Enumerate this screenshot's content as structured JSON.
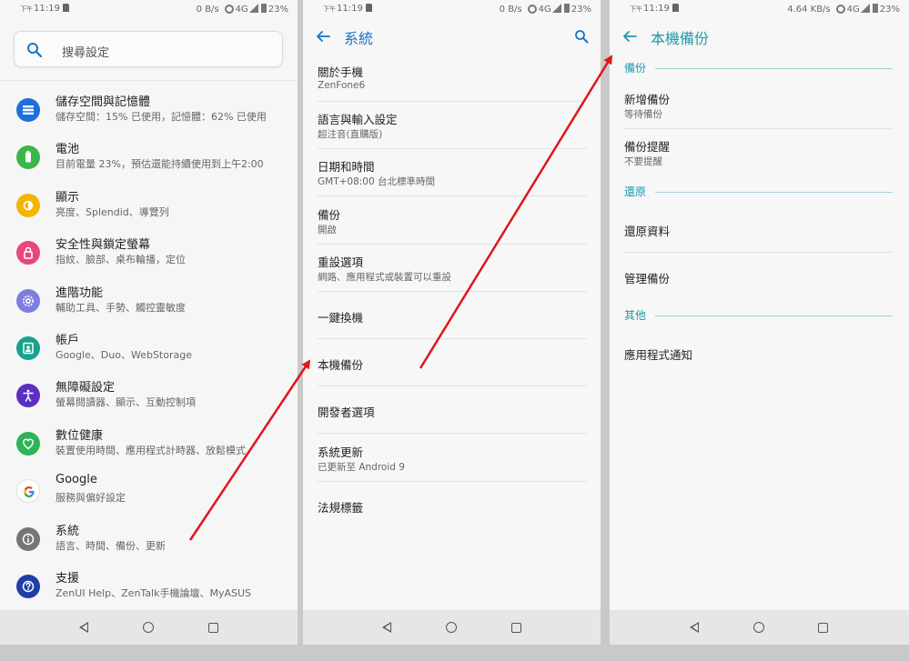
{
  "status": {
    "ampm": "下午",
    "time": "11:19",
    "speed_p1": "0 B/s",
    "speed_p2": "0 B/s",
    "speed_p3": "4.64 KB/s",
    "network": "4G",
    "battery": "23%"
  },
  "settings": {
    "search_placeholder": "搜尋設定",
    "items": [
      {
        "title": "儲存空間與記憶體",
        "subtitle": "儲存空間：15% 已使用，記憶體：62% 已使用",
        "icon": "storage-icon",
        "color": "#1e6fd9"
      },
      {
        "title": "電池",
        "subtitle": "目前電量 23%，預估還能持續使用到上午2:00",
        "icon": "battery-icon",
        "color": "#3cb54a"
      },
      {
        "title": "顯示",
        "subtitle": "亮度、Splendid、導覽列",
        "icon": "display-icon",
        "color": "#f4b400"
      },
      {
        "title": "安全性與鎖定螢幕",
        "subtitle": "指紋、臉部、桌布輪播，定位",
        "icon": "lock-icon",
        "color": "#e8477a"
      },
      {
        "title": "進階功能",
        "subtitle": "輔助工具、手勢、觸控靈敏度",
        "icon": "advanced-gear-icon",
        "color": "#7e7ee0"
      },
      {
        "title": "帳戶",
        "subtitle": "Google、Duo、WebStorage",
        "icon": "account-icon",
        "color": "#17a28c"
      },
      {
        "title": "無障礙設定",
        "subtitle": "螢幕閱讀器、顯示、互動控制項",
        "icon": "accessibility-icon",
        "color": "#5b2ec4"
      },
      {
        "title": "數位健康",
        "subtitle": "裝置使用時間、應用程式計時器、放鬆模式",
        "icon": "wellbeing-icon",
        "color": "#2db456"
      },
      {
        "title": "Google",
        "subtitle": "服務與偏好設定",
        "icon": "google-icon",
        "color": "#1a73e8"
      },
      {
        "title": "系統",
        "subtitle": "語言、時間、備份、更新",
        "icon": "info-icon",
        "color": "#757575"
      },
      {
        "title": "支援",
        "subtitle": "ZenUI Help、ZenTalk手機論壇、MyASUS",
        "icon": "help-icon",
        "color": "#1e3fa8"
      }
    ]
  },
  "system": {
    "title": "系統",
    "items": [
      {
        "title": "關於手機",
        "subtitle": "ZenFone6"
      },
      {
        "title": "語言與輸入設定",
        "subtitle": "超注音(直購版)"
      },
      {
        "title": "日期和時間",
        "subtitle": "GMT+08:00 台北標準時間"
      },
      {
        "title": "備份",
        "subtitle": "開啟"
      },
      {
        "title": "重設選項",
        "subtitle": "網路、應用程式或裝置可以重設"
      },
      {
        "title": "一鍵換機",
        "subtitle": ""
      },
      {
        "title": "本機備份",
        "subtitle": ""
      },
      {
        "title": "開發者選項",
        "subtitle": ""
      },
      {
        "title": "系統更新",
        "subtitle": "已更新至 Android 9"
      },
      {
        "title": "法規標籤",
        "subtitle": ""
      }
    ]
  },
  "local_backup": {
    "title": "本機備份",
    "sections": [
      {
        "header": "備份",
        "items": [
          {
            "title": "新增備份",
            "subtitle": "等待備份"
          },
          {
            "title": "備份提醒",
            "subtitle": "不要提醒"
          }
        ]
      },
      {
        "header": "還原",
        "items": [
          {
            "title": "還原資料",
            "subtitle": ""
          },
          {
            "title": "管理備份",
            "subtitle": ""
          }
        ]
      },
      {
        "header": "其他",
        "items": [
          {
            "title": "應用程式通知",
            "subtitle": ""
          }
        ]
      }
    ]
  },
  "colors": {
    "accent_blue": "#1a73c8",
    "accent_teal": "#1e9aa8",
    "arrow_red": "#e0161b"
  }
}
